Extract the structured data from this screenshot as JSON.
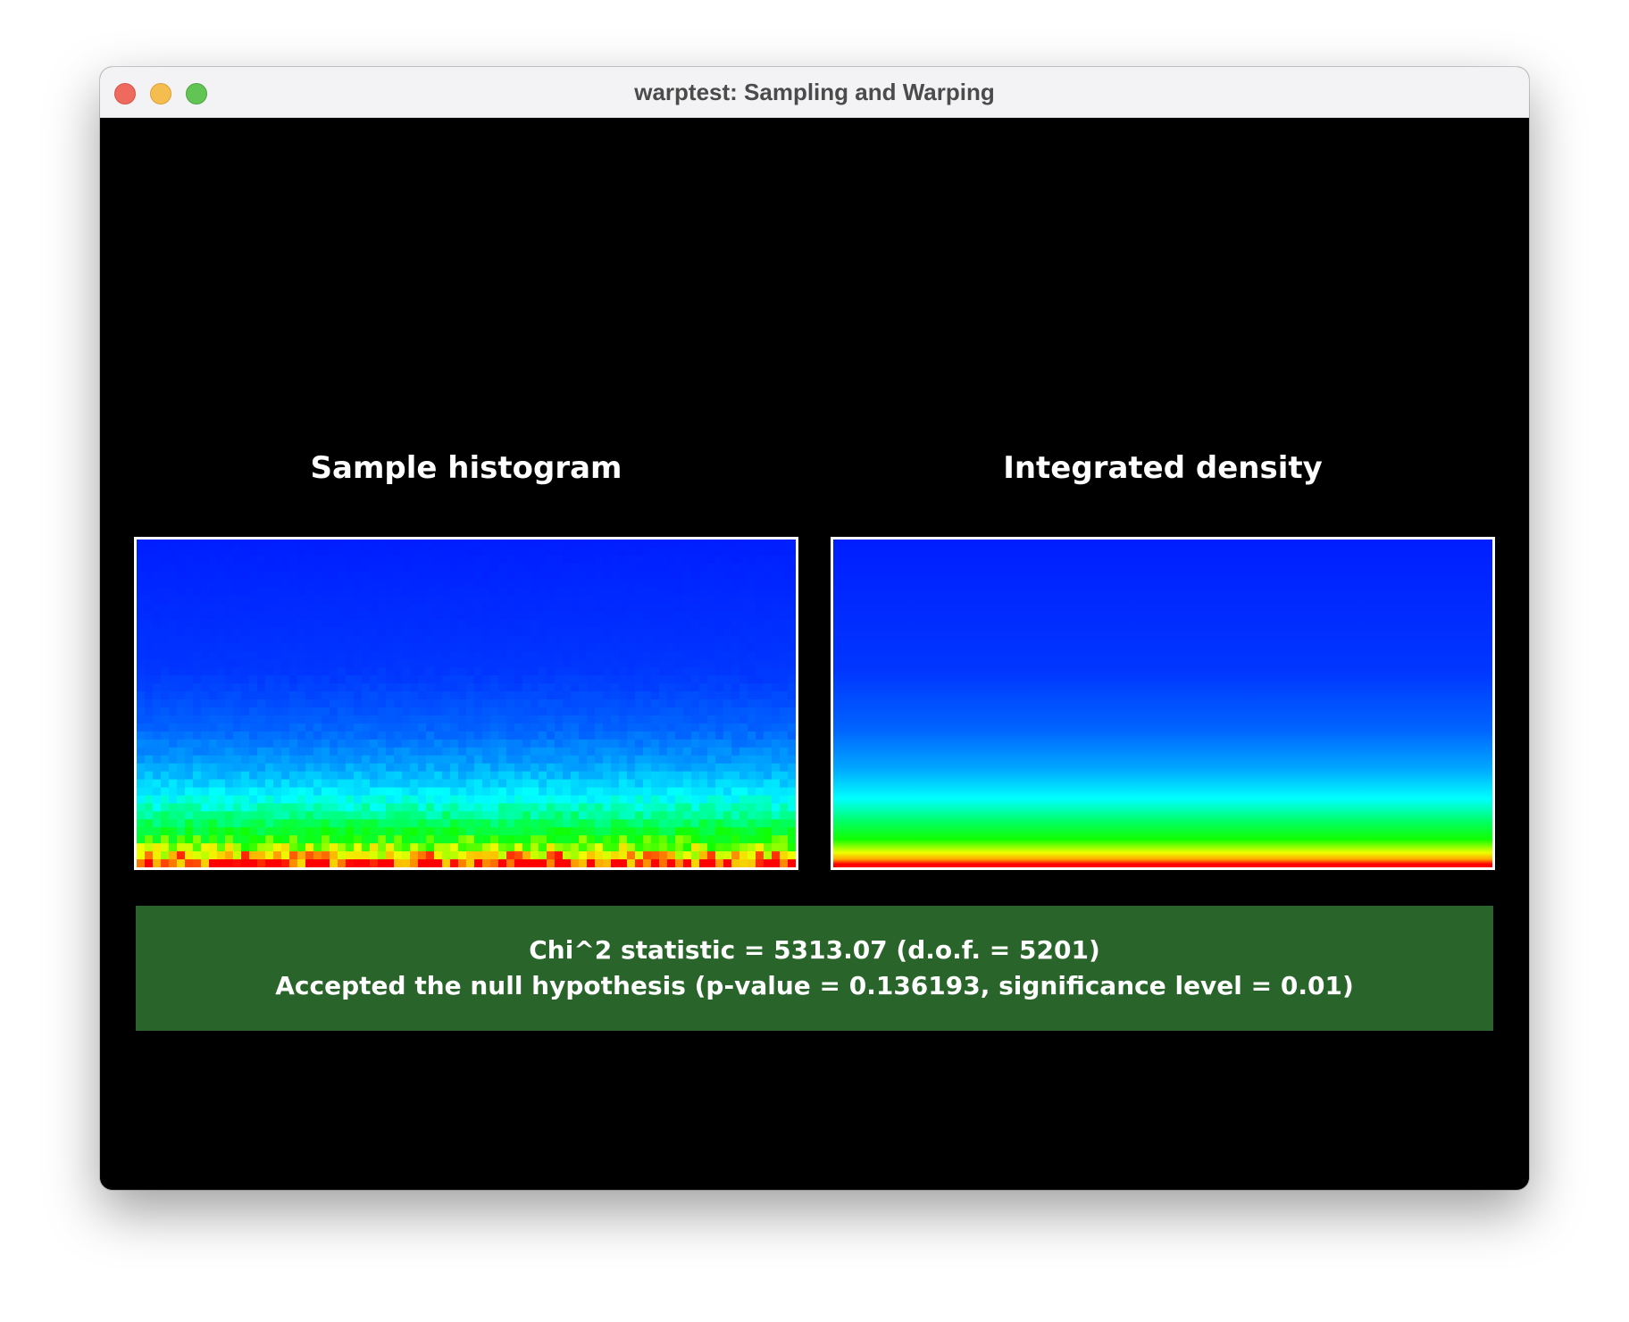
{
  "window": {
    "title": "warptest: Sampling and Warping"
  },
  "panels": {
    "left": {
      "label": "Sample histogram"
    },
    "right": {
      "label": "Integrated density"
    }
  },
  "colormap": {
    "low": "#0022ff",
    "mid_low": "#0088ff",
    "mid": "#00ffff",
    "mid_high": "#00ff00",
    "high": "#ffff00",
    "max": "#ff0000"
  },
  "result": {
    "status": "accepted",
    "background": "#29652a",
    "line1": "Chi^2 statistic = 5313.07 (d.o.f. = 5201)",
    "line2": "Accepted the null hypothesis (p-value = 0.136193, significance level = 0.01)"
  }
}
